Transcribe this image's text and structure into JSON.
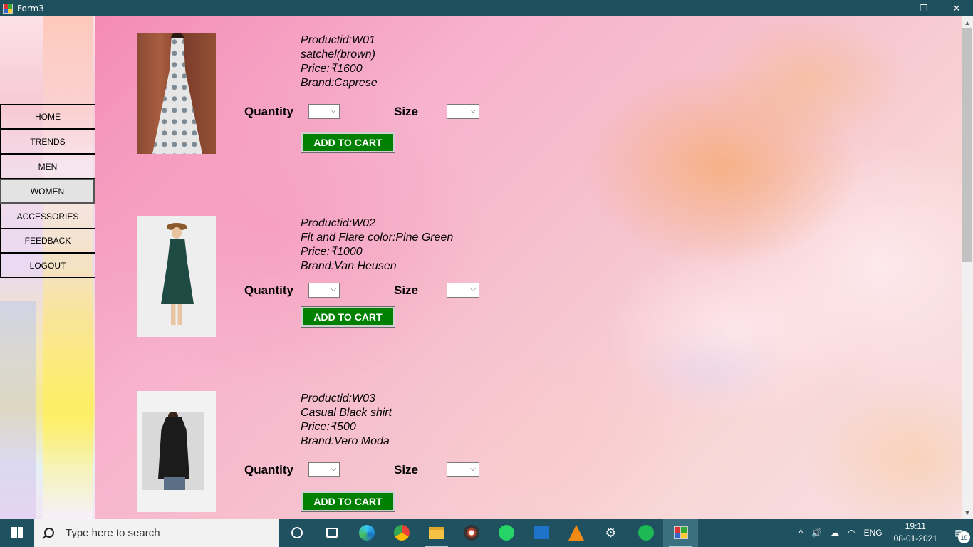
{
  "window": {
    "title": "Form3",
    "minimize": "—",
    "restore": "❐",
    "close": "✕"
  },
  "sidebar": {
    "items": [
      {
        "label": "HOME"
      },
      {
        "label": "TRENDS"
      },
      {
        "label": "MEN"
      },
      {
        "label": "WOMEN",
        "active": true
      },
      {
        "label": "ACCESSORIES"
      },
      {
        "label": "FEEDBACK"
      },
      {
        "label": "LOGOUT"
      }
    ]
  },
  "products": [
    {
      "id": "Productid:W01",
      "name": "satchel(brown)",
      "price": "Price:₹1600",
      "brand": "Brand:Caprese",
      "quantity_label": "Quantity",
      "size_label": "Size",
      "quantity_value": "",
      "size_value": "",
      "cart_label": "ADD TO CART"
    },
    {
      "id": "Productid:W02",
      "name": "Fit and Flare color:Pine Green",
      "price": "Price:₹1000",
      "brand": "Brand:Van Heusen",
      "quantity_label": "Quantity",
      "size_label": "Size",
      "quantity_value": "",
      "size_value": "",
      "cart_label": "ADD TO CART"
    },
    {
      "id": "Productid:W03",
      "name": "Casual Black shirt",
      "price": "Price:₹500",
      "brand": "Brand:Vero Moda",
      "quantity_label": "Quantity",
      "size_label": "Size",
      "quantity_value": "",
      "size_value": "",
      "cart_label": "ADD TO CART"
    }
  ],
  "scrollbar": {
    "up": "▲",
    "down": "▼"
  },
  "taskbar": {
    "search_placeholder": "Type here to search",
    "apps": [
      "cortana-icon",
      "task-view-icon",
      "edge-icon",
      "chrome-icon",
      "file-explorer-icon",
      "media-player-icon",
      "whatsapp-icon",
      "video-player-icon",
      "vlc-icon",
      "settings-icon",
      "spotify-icon",
      "winforms-app-icon"
    ],
    "tray": {
      "chevron": "^",
      "language": "ENG",
      "time": "19:11",
      "date": "08-01-2021",
      "notification_count": "19"
    }
  },
  "colors": {
    "titlebar": "#1e4f5c",
    "cart_button": "#008000",
    "taskbar": "#1f5160"
  }
}
